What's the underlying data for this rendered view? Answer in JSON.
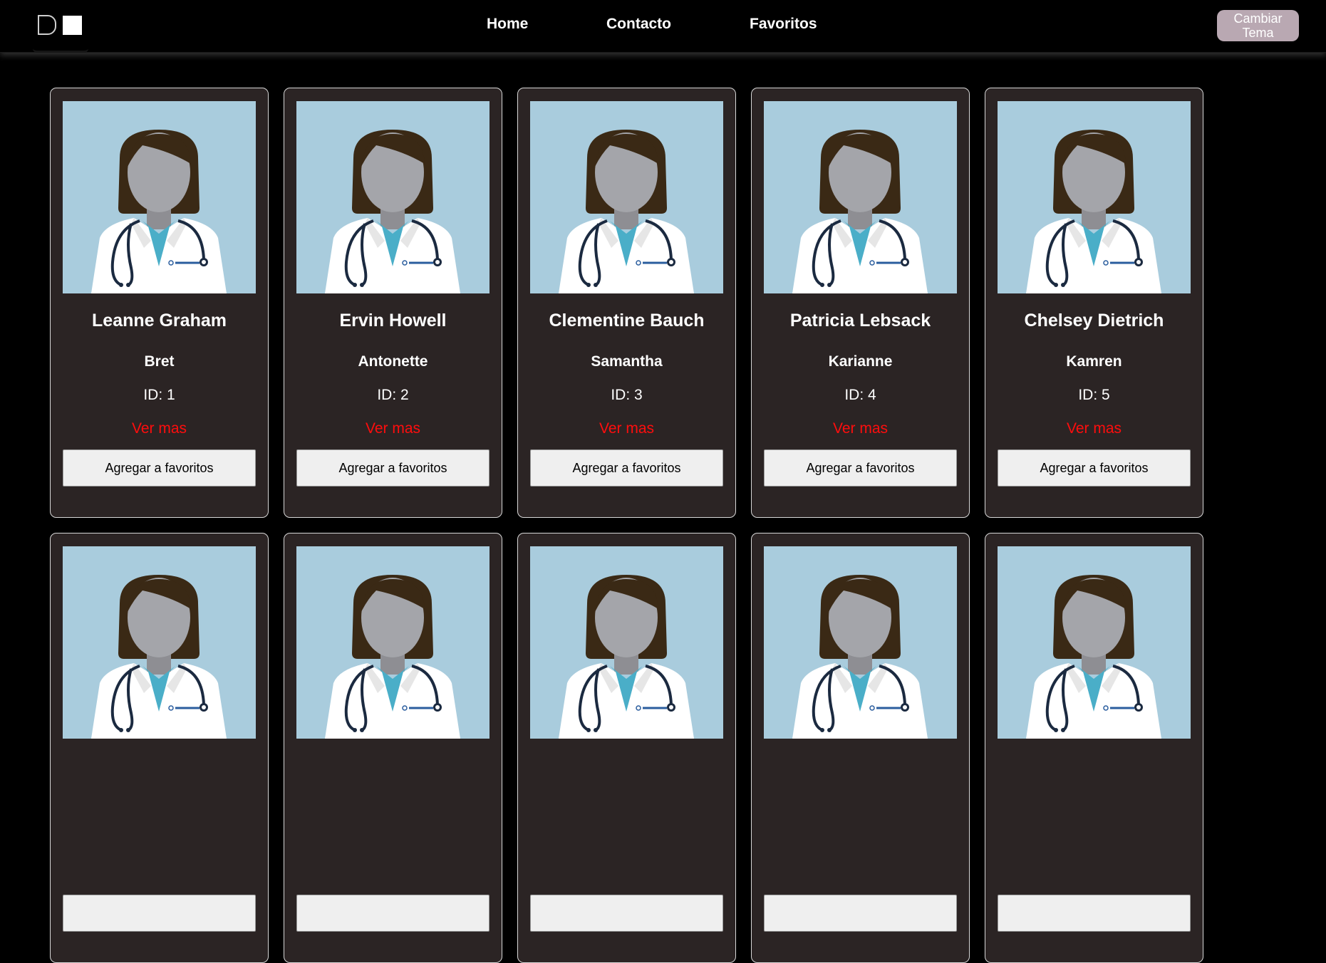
{
  "nav": {
    "links": [
      "Home",
      "Contacto",
      "Favoritos"
    ],
    "theme_button": "Cambiar Tema"
  },
  "cards": [
    {
      "name": "Leanne Graham",
      "username": "Bret",
      "id_text": "ID: 1",
      "more": "Ver mas",
      "fav": "Agregar a favoritos"
    },
    {
      "name": "Ervin Howell",
      "username": "Antonette",
      "id_text": "ID: 2",
      "more": "Ver mas",
      "fav": "Agregar a favoritos"
    },
    {
      "name": "Clementine Bauch",
      "username": "Samantha",
      "id_text": "ID: 3",
      "more": "Ver mas",
      "fav": "Agregar a favoritos"
    },
    {
      "name": "Patricia Lebsack",
      "username": "Karianne",
      "id_text": "ID: 4",
      "more": "Ver mas",
      "fav": "Agregar a favoritos"
    },
    {
      "name": "Chelsey Dietrich",
      "username": "Kamren",
      "id_text": "ID: 5",
      "more": "Ver mas",
      "fav": "Agregar a favoritos"
    },
    {},
    {},
    {},
    {},
    {}
  ],
  "avatar_icon": "doctor-avatar-icon",
  "colors": {
    "background": "#000000",
    "card": "#2b2424",
    "link_red": "#ff0d0d",
    "theme_button": "#b9a8b2",
    "avatar_bg": "#a9ccdd"
  }
}
